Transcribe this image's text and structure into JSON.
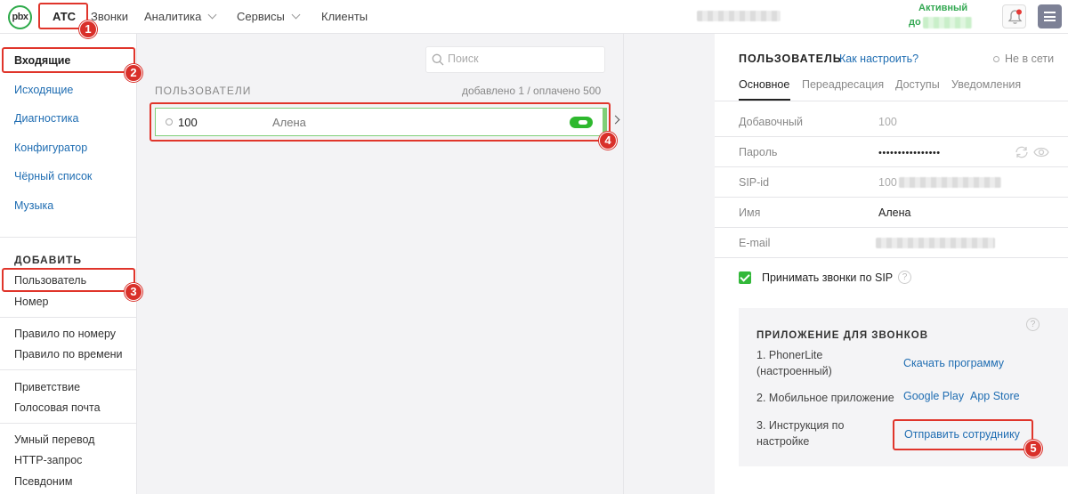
{
  "topbar": {
    "logo": "pbx",
    "nav": [
      {
        "label": "АТС"
      },
      {
        "label": "Звонки"
      },
      {
        "label": "Аналитика"
      },
      {
        "label": "Сервисы"
      },
      {
        "label": "Клиенты"
      }
    ],
    "status_active": "Активный",
    "status_until": "до"
  },
  "sidebar": {
    "main": [
      "Входящие",
      "Исходящие",
      "Диагностика",
      "Конфигуратор",
      "Чёрный список",
      "Музыка"
    ],
    "add_heading": "ДОБАВИТЬ",
    "add_items": [
      "Пользователь",
      "Номер"
    ],
    "group2": [
      "Правило по номеру",
      "Правило по времени"
    ],
    "group3": [
      "Приветствие",
      "Голосовая почта"
    ],
    "group4": [
      "Умный перевод",
      "HTTP-запрос",
      "Псевдоним"
    ]
  },
  "users": {
    "search_placeholder": "Поиск",
    "heading": "ПОЛЬЗОВАТЕЛИ",
    "count": "добавлено 1 / оплачено 500",
    "rows": [
      {
        "ext": "100",
        "name": "Алена",
        "enabled": true
      }
    ]
  },
  "panel": {
    "title": "ПОЛЬЗОВАТЕЛЬ",
    "help_link": "Как настроить?",
    "status": "Не в сети",
    "tabs": [
      "Основное",
      "Переадресация",
      "Доступы",
      "Уведомления"
    ],
    "fields": [
      {
        "label": "Добавочный",
        "value": "100"
      },
      {
        "label": "Пароль",
        "value": "••••••••••••••••"
      },
      {
        "label": "SIP-id",
        "value": "100"
      },
      {
        "label": "Имя",
        "value": "Алена"
      },
      {
        "label": "E-mail",
        "value": ""
      }
    ],
    "sip_checkbox_label": "Принимать звонки по SIP",
    "app": {
      "title": "ПРИЛОЖЕНИЕ ДЛЯ ЗВОНКОВ",
      "step1_line1": "1. PhonerLite",
      "step1_line2": "(настроенный)",
      "step1_link": "Скачать программу",
      "step2": "2. Мобильное приложение",
      "step2_link_a": "Google Play",
      "step2_link_b": "App Store",
      "step3_line1": "3. Инструкция по",
      "step3_line2": "настройке",
      "step3_link": "Отправить сотруднику"
    }
  },
  "annotations": [
    "1",
    "2",
    "3",
    "4",
    "5"
  ],
  "colors": {
    "accent_link": "#1f6db2",
    "active_green": "#33a852",
    "highlight_red": "#e0352b"
  }
}
